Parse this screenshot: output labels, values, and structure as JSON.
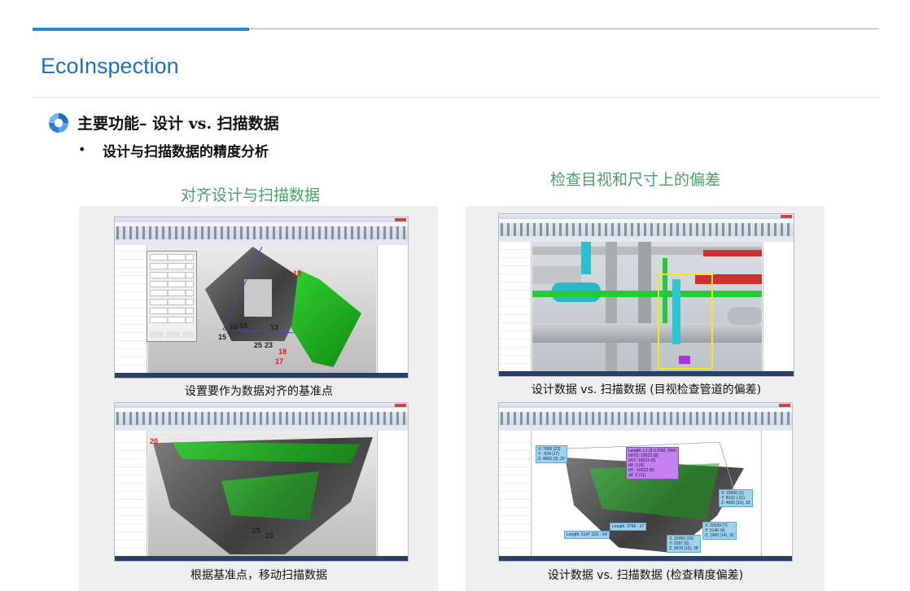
{
  "page": {
    "title": "EcoInspection",
    "heading": "主要功能– 设计 vs. 扫描数据",
    "sub_bullet": "•",
    "sub_heading": "设计与扫描数据的精度分析"
  },
  "sections": {
    "left_title": "对齐设计与扫描数据",
    "right_title": "检查目视和尺寸上的偏差"
  },
  "screenshots": [
    {
      "caption": "设置要作为数据对齐的基准点",
      "point_labels": [
        "19",
        "16",
        "18",
        "13",
        "15",
        "25",
        "23",
        "18",
        "17"
      ]
    },
    {
      "caption": "设计数据 vs. 扫描数据 (目视检查管道的偏差)",
      "point_labels": []
    },
    {
      "caption": "根据基准点，移动扫描数据",
      "point_labels": [
        "20",
        "25",
        "23"
      ]
    },
    {
      "caption": "设计数据 vs. 扫描数据 (检查精度偏差)",
      "callouts": {
        "top_left": [
          "X: 7800 (23)",
          "Y: -524 (17)",
          "Z: 4600 (3), 20"
        ],
        "purple": [
          "Length: L1 (8.0-20M; 28M)",
          "dXYZ: 16623 (8)",
          "dXY: 16623 (8)",
          "dX: 0 (4)",
          "dY: -16623 (8)",
          "dZ: 0 (11)"
        ],
        "right_top": [
          "X: 22600 (1)",
          "Y: 8132 (-21)",
          "Z: 4600 (12), 33"
        ],
        "right_mid": [
          "X: 22630 (7)",
          "Y: 5146 (4)",
          "Z: 1960 (14), 32"
        ],
        "bottom": [
          "X: 22450 (16)",
          "Y: 2197 (6)",
          "Z: 3678 (10), 38"
        ],
        "length1": "Length: 3768 ; X7",
        "length2": "Length: 5147 (32) ; X4"
      }
    }
  ],
  "colors": {
    "accent_blue": "#2a86d8",
    "title_blue": "#1f6fc0",
    "caption_green": "#4aa268",
    "scan_green": "#22b022",
    "callout_blue": "#9fd2ee",
    "callout_purple": "#c580f2",
    "highlight_yellow": "#f3e61a"
  },
  "icons": {
    "bullet": "ring-bullet-icon"
  }
}
